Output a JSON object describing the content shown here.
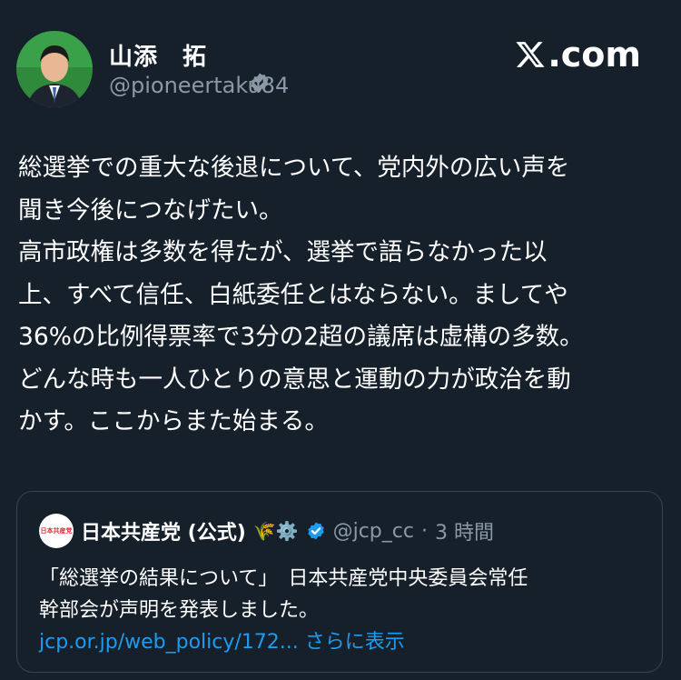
{
  "author": {
    "name": "山添　拓",
    "handle": "@pioneertaku84",
    "verified_icon": "verified-badge-icon"
  },
  "brand": {
    "label": ".com",
    "icon": "x-logo-icon"
  },
  "tweet": {
    "lines": [
      "総選挙での重大な後退について、党内外の広い声を",
      "聞き今後につなげたい。",
      "高市政権は多数を得たが、選挙で語らなかった以",
      "上、すべて信任、白紙委任とはならない。ましてや",
      "36%の比例得票率で3分の2超の議席は虚構の多数。",
      "どんな時も一人ひとりの意思と運動の力が政治を動",
      "かす。ここからまた始まる。"
    ]
  },
  "quote": {
    "logo_text": "日本共産党",
    "name": "日本共産党 (公式)",
    "emoji": "🌾⚙️",
    "handle": "@jcp_cc",
    "separator": "·",
    "time": "3 時間",
    "body_lines": [
      "「総選挙の結果について」　日本共産党中央委員会常任",
      "幹部会が声明を発表しました。"
    ],
    "link": "jcp.or.jp/web_policy/172...",
    "more": "さらに表示"
  },
  "colors": {
    "background": "#15202b",
    "secondary_text": "#8b98a5",
    "link": "#1d9bf0",
    "verified": "#1d9bf0"
  }
}
